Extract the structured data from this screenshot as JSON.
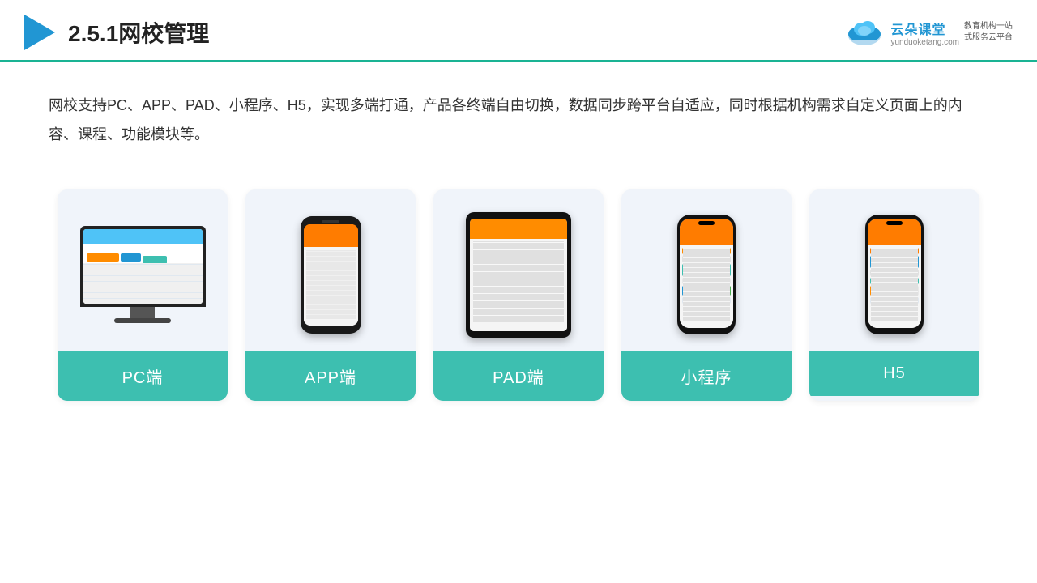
{
  "header": {
    "title": "2.5.1网校管理",
    "brand": {
      "name": "云朵课堂",
      "url": "yunduoketang.com",
      "slogan": "教育机构一站\n式服务云平台"
    }
  },
  "description": {
    "text": "网校支持PC、APP、PAD、小程序、H5，实现多端打通，产品各终端自由切换，数据同步跨平台自适应，同时根据机构需求自定义页面上的内容、课程、功能模块等。"
  },
  "cards": [
    {
      "id": "pc",
      "label": "PC端"
    },
    {
      "id": "app",
      "label": "APP端"
    },
    {
      "id": "pad",
      "label": "PAD端"
    },
    {
      "id": "miniprogram",
      "label": "小程序"
    },
    {
      "id": "h5",
      "label": "H5"
    }
  ]
}
